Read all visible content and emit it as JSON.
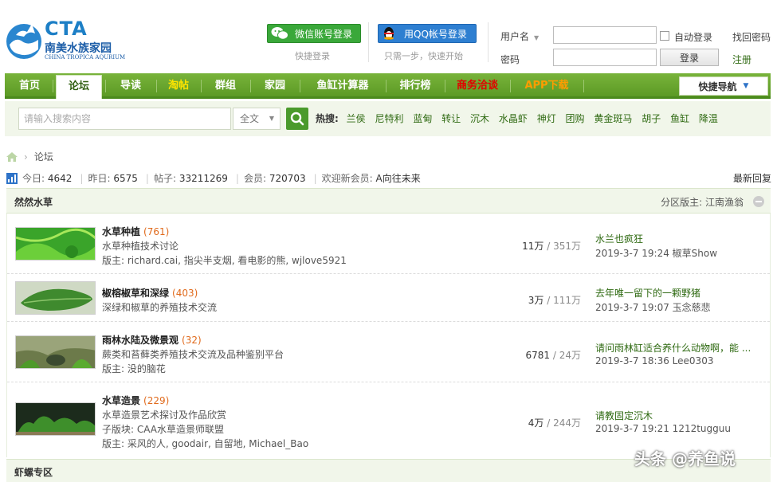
{
  "logo": {
    "mark": "CTA",
    "name_cn": "南美水族家园",
    "name_en": "CHINA TROPICA AQURIUM"
  },
  "social": {
    "wechat_label": "微信账号登录",
    "wechat_sub": "快捷登录",
    "qq_label": "用QQ帐号登录",
    "qq_sub": "只需一步，快速开始"
  },
  "login": {
    "username_label": "用户名",
    "password_label": "密码",
    "auto_login": "自动登录",
    "login_button": "登录",
    "find_password": "找回密码",
    "register": "注册"
  },
  "nav": {
    "items": [
      "首页",
      "论坛",
      "导读",
      "淘帖",
      "群组",
      "家园",
      "鱼缸计算器",
      "排行榜",
      "商务洽谈",
      "APP下载"
    ],
    "active": "论坛",
    "quick_nav": "快捷导航"
  },
  "search": {
    "placeholder": "请输入搜索内容",
    "scope": "全文",
    "hot_label": "热搜:",
    "hot": [
      "兰侯",
      "尼特利",
      "蓝甸",
      "转让",
      "沉木",
      "水晶虾",
      "神灯",
      "团购",
      "黄金斑马",
      "胡子",
      "鱼缸",
      "降温"
    ]
  },
  "breadcrumb": {
    "current": "论坛"
  },
  "stats": {
    "today_label": "今日:",
    "today": "4642",
    "yesterday_label": "昨日:",
    "yesterday": "6575",
    "posts_label": "帖子:",
    "posts": "33211269",
    "members_label": "会员:",
    "members": "720703",
    "welcome_label": "欢迎新会员:",
    "welcome_member": "A向往未来",
    "latest_reply": "最新回复"
  },
  "category": {
    "title": "然然水草",
    "moderator": "分区版主: 江南渔翁",
    "forums": [
      {
        "title": "水草种植",
        "count": "(761)",
        "desc": "水草种植技术讨论",
        "extra": "",
        "mods": "版主: richard.cai, 指尖半支烟, 看电影的熊, wjlove5921",
        "topics": "11万",
        "posts": "351万",
        "last_title": "水兰也疯狂",
        "last_meta": "2019-3-7 19:24 椒草Show"
      },
      {
        "title": "椒榕椒草和深绿",
        "count": "(403)",
        "desc": "深绿和椒草的养殖技术交流",
        "extra": "",
        "mods": "",
        "topics": "3万",
        "posts": "111万",
        "last_title": "去年唯一留下的一颗野猪",
        "last_meta": "2019-3-7 19:07 玉念慈悲"
      },
      {
        "title": "雨林水陆及微景观",
        "count": "(32)",
        "desc": "蕨类和苔藓类养殖技术交流及品种鉴别平台",
        "extra": "",
        "mods": "版主: 没的脑花",
        "topics": "6781",
        "posts": "24万",
        "last_title": "请问雨林缸适合养什么动物啊，能 ...",
        "last_meta": "2019-3-7 18:36 Lee0303"
      },
      {
        "title": "水草造景",
        "count": "(229)",
        "desc": "水草造景艺术探讨及作品欣赏",
        "extra": "子版块: CAA水草造景师联盟",
        "mods": "版主: 采风的人, goodair, 自留地, Michael_Bao",
        "topics": "4万",
        "posts": "244万",
        "last_title": "请教固定沉木",
        "last_meta": "2019-3-7 19:21 1212tugguu"
      }
    ]
  },
  "category2": {
    "title": "虾螺专区"
  },
  "watermark": "头条 @养鱼说",
  "colors": {
    "nav_green": "#6aa82f",
    "link_green": "#2f6a12",
    "count_orange": "#e06a1c",
    "nav_yellow": "#ffe400",
    "nav_red": "#e20000",
    "nav_orange": "#ff9c00"
  }
}
